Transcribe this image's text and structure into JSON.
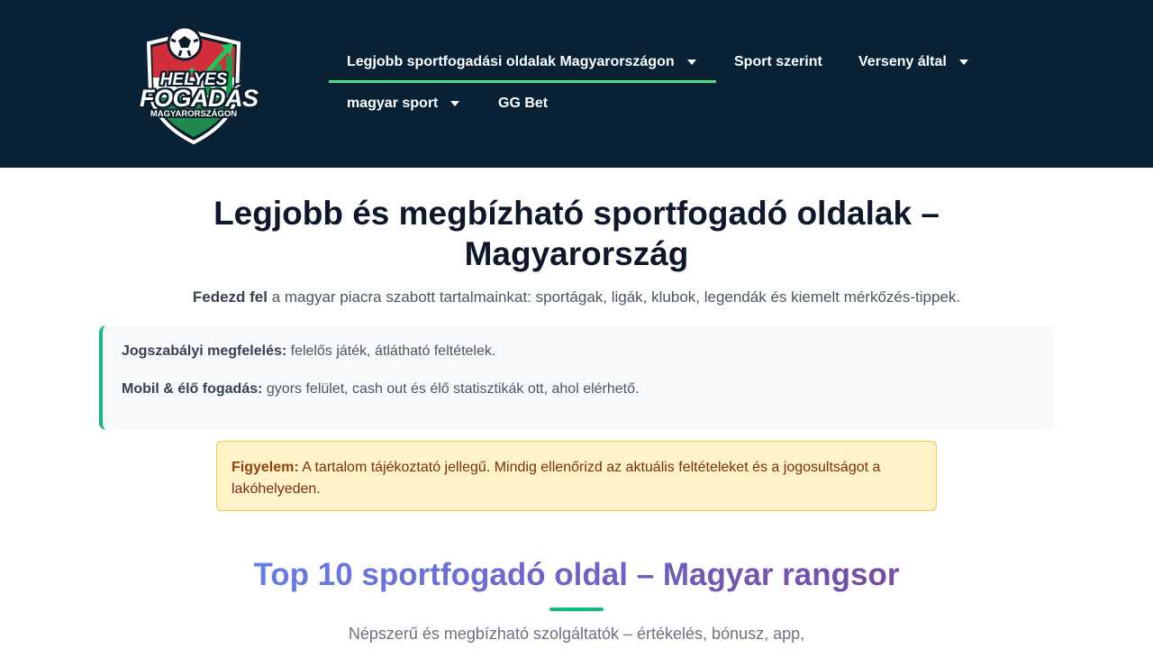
{
  "header": {
    "logo": {
      "line1": "HELYES",
      "line2": "FOGADÁS",
      "line3": "MAGYARORSZÁGON"
    },
    "nav": [
      {
        "label": "Legjobb sportfogadási oldalak Magyarországon",
        "has_dropdown": true,
        "active": true
      },
      {
        "label": "Sport szerint",
        "has_dropdown": false
      },
      {
        "label": "Verseny által",
        "has_dropdown": true
      },
      {
        "label": "magyar sport",
        "has_dropdown": true
      },
      {
        "label": "GG Bet",
        "has_dropdown": false
      }
    ]
  },
  "main": {
    "title": "Legjobb és megbízható sportfogadó oldalak – Magyarország",
    "intro": {
      "bold": "Fedezd fel",
      "rest": " a magyar piacra szabott tartalmainkat: sportágak, ligák, klubok, legendák és kiemelt mérkőzés-tippek."
    },
    "info": [
      {
        "bold": "Jogszabályi megfelelés:",
        "text": " felelős játék, átlátható feltételek."
      },
      {
        "bold": "Mobil & élő fogadás:",
        "text": " gyors felület, cash out és élő statisztikák ott, ahol elérhető."
      }
    ],
    "warning": {
      "bold": "Figyelem:",
      "text": " A tartalom tájékoztató jellegű. Mindig ellenőrizd az aktuális feltételeket és a jogosultságot a lakóhelyeden."
    },
    "section": {
      "title": "Top 10 sportfogadó oldal – Magyar rangsor",
      "subtitle": "Népszerű és megbízható szolgáltatók – értékelés, bónusz, app,"
    }
  },
  "colors": {
    "header_bg": "#082134",
    "accent_green": "#10b981",
    "nav_active": "#4ade80",
    "warning_bg": "#fef3c7",
    "gradient_start": "#667eea",
    "gradient_end": "#764ba2"
  }
}
